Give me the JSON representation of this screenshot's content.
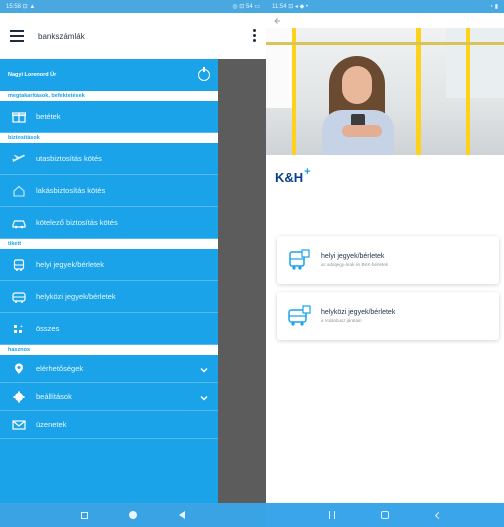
{
  "left": {
    "status": {
      "time": "15:58 ⊡ ▲",
      "right": "◎ ⊡ 54 ▭"
    },
    "appbar": {
      "title": "bankszámlák"
    },
    "drawer": {
      "header": {
        "greeting": "Nagyi Lorenord Úr"
      },
      "sections": [
        {
          "label": "megtakarítások, befektetések"
        },
        {
          "label": "biztosítások"
        },
        {
          "label": "tikett"
        },
        {
          "label": "hasznos"
        }
      ],
      "items": {
        "betetek": "betétek",
        "utasbiztositas": "utasbiztosítás kötés",
        "lakasbiztositas": "lakásbiztosítás kötés",
        "kotelezo": "kötelező biztosítás kötés",
        "helyi": "helyi jegyek/bérletek",
        "helykozi": "helyközi jegyek/bérletek",
        "osszes": "összes",
        "elerhetosegek": "elérhetőségek",
        "beallitasok": "beállítások",
        "uzenetek": "üzenetek"
      }
    }
  },
  "right": {
    "status": {
      "time": "11:54 ⊡ ◂ ◆ •",
      "right": "◔ ▮"
    },
    "logo": {
      "text": "K&H",
      "plus": "+"
    },
    "cards": [
      {
        "title": "helyi jegyek/bérletek",
        "subtitle": "az adatjegy-árak és BKK-bérletek"
      },
      {
        "title": "helyközi jegyek/bérletek",
        "subtitle": "a Volánbusz járatain"
      }
    ]
  },
  "colors": {
    "accent": "#1aa3e8",
    "dim": "#5c5c5c",
    "brand": "#0b3f8c"
  },
  "icons": [
    "hamburger-menu-icon",
    "kebab-menu-icon",
    "power-icon",
    "gift-icon",
    "plane-icon",
    "house-icon",
    "car-icon",
    "bus-icon",
    "coach-icon",
    "grid-icon",
    "location-pin-icon",
    "gear-icon",
    "envelope-icon",
    "chevron-down-icon",
    "back-arrow-icon"
  ]
}
